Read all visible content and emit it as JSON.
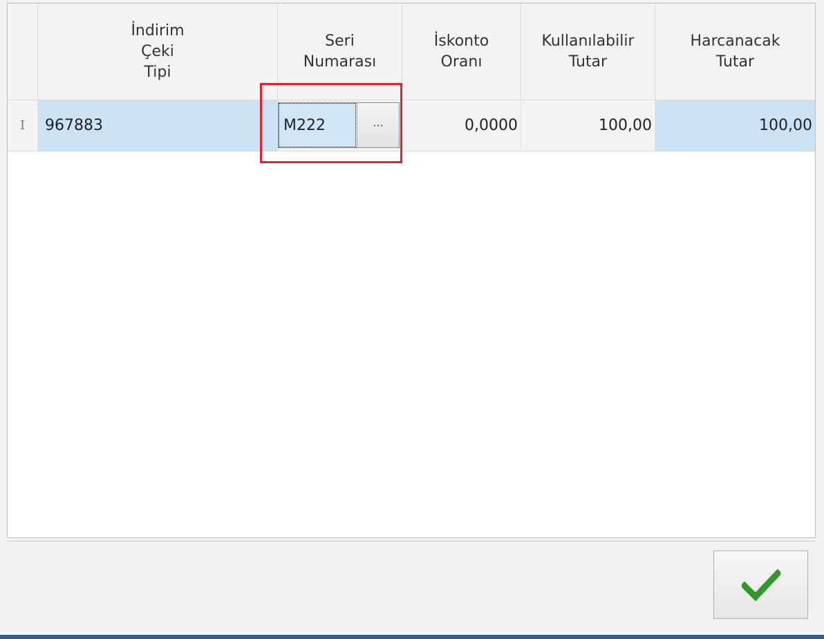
{
  "grid": {
    "columns": [
      {
        "label": "İndirim\nÇeki\nTipi"
      },
      {
        "label": "Seri\nNumarası"
      },
      {
        "label": "İskonto\nOranı"
      },
      {
        "label": "Kullanılabilir\nTutar"
      },
      {
        "label": "Harcanacak\nTutar"
      }
    ],
    "rows": [
      {
        "indicator": "I",
        "indirim_ceki_tipi": "967883",
        "seri_numarasi": "M222",
        "ellipsis": "···",
        "iskonto_orani": "0,0000",
        "kullanilabilir_tutar": "100,00",
        "harcanacak_tutar": "100,00"
      }
    ]
  },
  "icons": {
    "ok_button": "checkmark-icon",
    "row_indicator": "text-cursor-icon"
  },
  "colors": {
    "selection": "#cce3f6",
    "highlight": "#e3232b",
    "checkmark": "#2f9a2a",
    "bottom_bar": "#2f5d9a"
  }
}
